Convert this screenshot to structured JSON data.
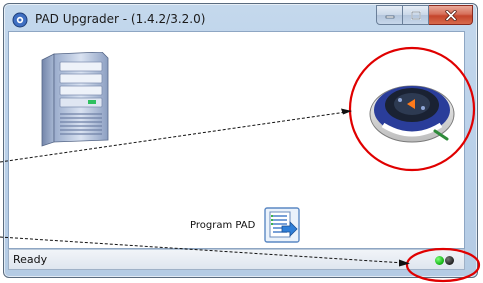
{
  "window": {
    "title": "PAD Upgrader - (1.4.2/3.2.0)"
  },
  "program": {
    "label": "Program PAD"
  },
  "status": {
    "text": "Ready"
  },
  "icons": {
    "app": "app-icon",
    "server": "server-computer-icon",
    "device": "aed-device-icon",
    "program": "program-pad-icon",
    "status_green": "green-status-led",
    "status_dark": "dark-status-led"
  },
  "colors": {
    "annotation_circle": "#e00000",
    "status_green": "#10b010",
    "device_blue": "#2a3d9a"
  }
}
